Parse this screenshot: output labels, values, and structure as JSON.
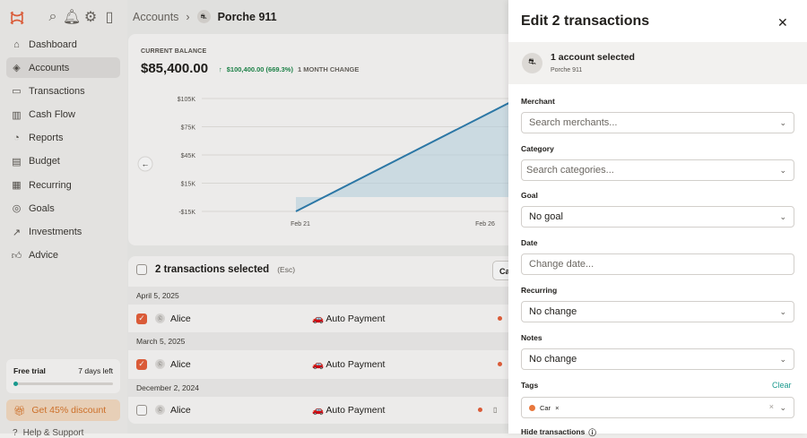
{
  "sidebar": {
    "items": [
      {
        "label": "Dashboard",
        "icon": "home-icon"
      },
      {
        "label": "Accounts",
        "icon": "layers-icon"
      },
      {
        "label": "Transactions",
        "icon": "card-icon"
      },
      {
        "label": "Cash Flow",
        "icon": "bar-chart-icon"
      },
      {
        "label": "Reports",
        "icon": "pie-chart-icon"
      },
      {
        "label": "Budget",
        "icon": "map-icon"
      },
      {
        "label": "Recurring",
        "icon": "calendar-icon"
      },
      {
        "label": "Goals",
        "icon": "target-icon"
      },
      {
        "label": "Investments",
        "icon": "trend-up-icon"
      },
      {
        "label": "Advice",
        "icon": "thumbs-up-icon"
      }
    ],
    "active": "Accounts",
    "trial": {
      "label": "Free trial",
      "days": "7 days left",
      "progress": 0.04
    },
    "discount": "Get 45% discount",
    "help": "Help & Support"
  },
  "breadcrumb": {
    "parent": "Accounts",
    "current": "Porche 911"
  },
  "balance": {
    "label": "CURRENT BALANCE",
    "value": "$85,400.00",
    "change": "$100,400.00 (669.3%)",
    "period": "1 MONTH CHANGE"
  },
  "chart_data": {
    "type": "area",
    "y_ticks": [
      "$105K",
      "$75K",
      "$45K",
      "$15K",
      "-$15K"
    ],
    "x_ticks": [
      "Feb 21",
      "Feb 26"
    ],
    "series": [
      {
        "values": [
          -15000,
          100000,
          85400
        ]
      }
    ],
    "ylim": [
      -15000,
      105000
    ]
  },
  "list": {
    "header": "2 transactions selected",
    "esc": "(Esc)",
    "button": "Ca",
    "groups": [
      {
        "date": "April 5, 2025",
        "merchant": "Alice",
        "category": "🚗 Auto Payment",
        "checked": true
      },
      {
        "date": "March 5, 2025",
        "merchant": "Alice",
        "category": "🚗 Auto Payment",
        "checked": true
      },
      {
        "date": "December 2, 2024",
        "merchant": "Alice",
        "category": "🚗 Auto Payment",
        "checked": false
      }
    ]
  },
  "drawer": {
    "title": "Edit 2 transactions",
    "account_title": "1 account selected",
    "account_sub": "Porche 911",
    "merchant": {
      "label": "Merchant",
      "placeholder": "Search merchants..."
    },
    "category": {
      "label": "Category",
      "placeholder": "Search categories..."
    },
    "goal": {
      "label": "Goal",
      "value": "No goal"
    },
    "date": {
      "label": "Date",
      "placeholder": "Change date..."
    },
    "recurring": {
      "label": "Recurring",
      "value": "No change"
    },
    "notes": {
      "label": "Notes",
      "value": "No change"
    },
    "tags": {
      "label": "Tags",
      "clear": "Clear",
      "chip": "Car"
    },
    "hide": "Hide transactions"
  },
  "colors": {
    "accent": "#e8613c",
    "teal": "#1a9a8e",
    "line": "#2f7fb0"
  }
}
